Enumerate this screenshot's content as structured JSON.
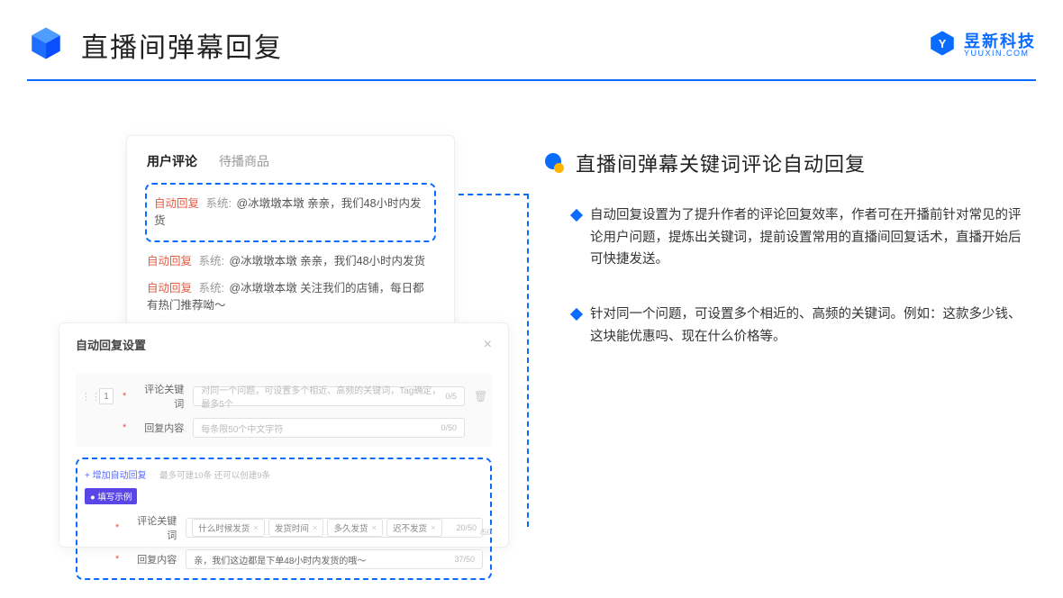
{
  "header": {
    "title": "直播间弹幕回复",
    "brand_cn": "昱新科技",
    "brand_en": "YUUXIN.COM"
  },
  "comments_card": {
    "tab_active": "用户评论",
    "tab_other": "待播商品",
    "items": [
      {
        "tag": "自动回复",
        "sys": "系统:",
        "body": "@冰墩墩本墩 亲亲，我们48小时内发货"
      },
      {
        "tag": "自动回复",
        "sys": "系统:",
        "body": "@冰墩墩本墩 亲亲，我们48小时内发货"
      },
      {
        "tag": "自动回复",
        "sys": "系统:",
        "body": "@冰墩墩本墩 关注我们的店铺，每日都有热门推荐呦～"
      }
    ]
  },
  "settings": {
    "title": "自动回复设置",
    "row_number": "1",
    "kw_label": "评论关键词",
    "kw_placeholder": "对同一个问题，可设置多个相近、高频的关键词，Tag确定，最多5个",
    "kw_counter": "0/5",
    "content_label": "回复内容",
    "content_placeholder": "每条限50个中文字符",
    "content_counter": "0/50",
    "add_link": "+ 增加自动回复",
    "add_hint": "最多可建10条 还可以创建9条",
    "example_badge": "● 填写示例",
    "example_kw_label": "评论关键词",
    "example_keywords": [
      "什么时候发货",
      "发货时间",
      "多久发货",
      "迟不发货"
    ],
    "example_kw_counter": "20/50",
    "example_content_label": "回复内容",
    "example_content_value": "亲，我们这边都是下单48小时内发货的哦～",
    "example_content_counter": "37/50",
    "partial_counter": "/50"
  },
  "right": {
    "title": "直播间弹幕关键词评论自动回复",
    "bullets": [
      "自动回复设置为了提升作者的评论回复效率，作者可在开播前针对常见的评论用户问题，提炼出关键词，提前设置常用的直播间回复话术，直播开始后可快捷发送。",
      "针对同一个问题，可设置多个相近的、高频的关键词。例如：这款多少钱、这块能优惠吗、现在什么价格等。"
    ]
  }
}
